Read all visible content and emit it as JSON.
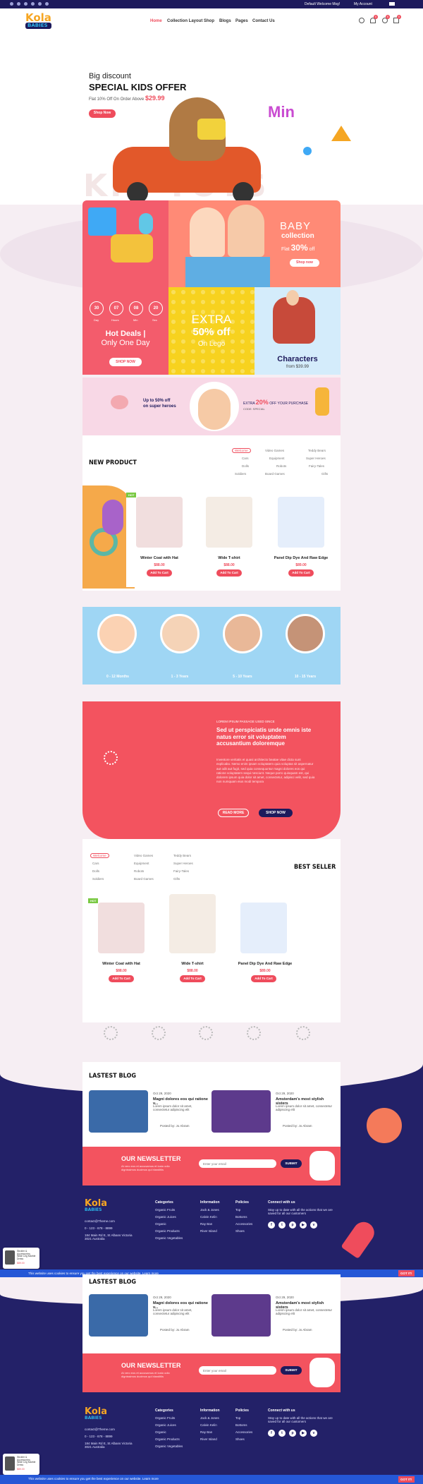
{
  "topbar": {
    "welcome": "Default Welcome Msg!",
    "account": "My Account"
  },
  "brand": {
    "line1": "Kola",
    "line2": "BABIES"
  },
  "nav": [
    "Home",
    "Collection Layout",
    "Shop",
    "Blogs",
    "Pages",
    "Contact Us"
  ],
  "header_badges": [
    "0",
    "0",
    "0"
  ],
  "hero": {
    "kicker": "Big discount",
    "title": "SPECIAL KIDS OFFER",
    "sub": "Flat 10% Off On Order Above",
    "price": "$29.99",
    "button": "Shop Now",
    "bg_text": "KID TOYS",
    "side_text": "Min"
  },
  "banner_baby": {
    "title": "BABY",
    "title2": "collection",
    "flat": "Flat",
    "pct": "30%",
    "off": "off",
    "button": "Shop now"
  },
  "deal": {
    "nums": [
      "30",
      "07",
      "08",
      "20"
    ],
    "labels": [
      "Day",
      "Hours",
      "Min",
      "Sec"
    ],
    "title1": "Hot Deals |",
    "title2": "Only One Day",
    "button": "SHOP NOW"
  },
  "lego": {
    "l1": "EXTRA",
    "l2": "50% off",
    "l3": "On Lego"
  },
  "characters": {
    "title": "Characters",
    "from": "from $39.99"
  },
  "promo_strip": {
    "left1": "Up to 50% off",
    "left2": "on super heroes",
    "extra": "EXTRA",
    "pct": "20%",
    "rest": "OFF YOUR PURCHASE",
    "code": "CODE: SPECIAL"
  },
  "categories": {
    "col1": [
      "Welcome",
      "Cars",
      "Dolls",
      "Soldiers"
    ],
    "col2": [
      "Video Games",
      "Equipment",
      "Robots",
      "Board Games"
    ],
    "col3": [
      "Teddy Bears",
      "Super Heroes",
      "Fairy-Tales",
      "Gifts"
    ]
  },
  "new_product": {
    "title": "NEW PRODUCT"
  },
  "products": [
    {
      "name": "Winter Coat with Hat",
      "price": "$88.00",
      "button": "Add To Cart",
      "tag": "HOT"
    },
    {
      "name": "Wide T-shirt",
      "price": "$88.00",
      "button": "Add To Cart"
    },
    {
      "name": "Panel Dip Dye And Raw Edge",
      "price": "$89.00",
      "button": "Add To Cart"
    }
  ],
  "ages": [
    "0 - 12 Months",
    "1 - 3 Years",
    "5 - 10 Years",
    "10 - 15 Years"
  ],
  "about": {
    "kicker": "LOREM IPSUM PASSAGE USED SINCE",
    "title": "Sed ut perspiciatis unde omnis iste natus error sit voluptatem accusantium doloremque",
    "body": "Inventore veritatis et quasi architecto beatae vitae dicta sunt explicabo. Nemo enim ipsam voluptatem quia voluptas sit aspernatur aut odit aut fugit, sed quia consequuntur magni dolores eos qui ratione voluptatem sequi nesciunt. Neque porro quisquam est, qui dolorem ipsum quia dolor sit amet, consectetur, adipisci velit, sed quia non numquam eius modi tempora",
    "btn1": "READ MORE",
    "btn2": "SHOP NOW"
  },
  "best_seller": {
    "title": "BEST SELLER"
  },
  "latest_blog": {
    "title": "LASTEST BLOG",
    "posts": [
      {
        "date": "Oct 29, 2020",
        "title": "Magni dolores eos qui ratione v...",
        "body": "Lorem ipsum dolor sit amet, consectetur adipiscing elit",
        "author": "Posted by: Jo Abram"
      },
      {
        "date": "Oct 29, 2020",
        "title": "Amsterdam's most stylish sisters",
        "body": "Lorem ipsum dolor sit amet, consectetur adipiscing elit",
        "author": "Posted by: Jo Abram"
      }
    ]
  },
  "newsletter": {
    "title": "OUR NEWSLETTER",
    "sub": "At vero eos et accusamus et iusto odio dignissimos ducimus qui blanditiis",
    "placeholder": "Enter your email",
    "button": "SUBMIT"
  },
  "footer": {
    "contact": [
      "contact@Theme.com",
      "0 - 123 - 678 - 8899",
      "184 Main Rd E, St Albans Victoria 3021 Australia"
    ],
    "cat_title": "Categories",
    "cats": [
      "Organic Fruits",
      "Organic Juices",
      "Organic",
      "Organic Products",
      "Organic Vegetables"
    ],
    "info_title": "Information",
    "info": [
      "Jack & Jones",
      "Calvin Kelin",
      "Ray Ban",
      "River Island"
    ],
    "pol_title": "Policies",
    "pol": [
      "Top",
      "Bottoms",
      "Accessories",
      "Shoes"
    ],
    "connect_title": "Connect with us",
    "connect_text": "Stay up to date with all the actions that we are saved for all our customers"
  },
  "cookie": {
    "text": "This website uses cookies to ensure you get the best experience on our website. Learn more",
    "button": "GOT IT!"
  },
  "toast": {
    "line1": "Stroller & Accessories",
    "line2": "Wide Leg Marble Dress",
    "price": "$89.00"
  }
}
